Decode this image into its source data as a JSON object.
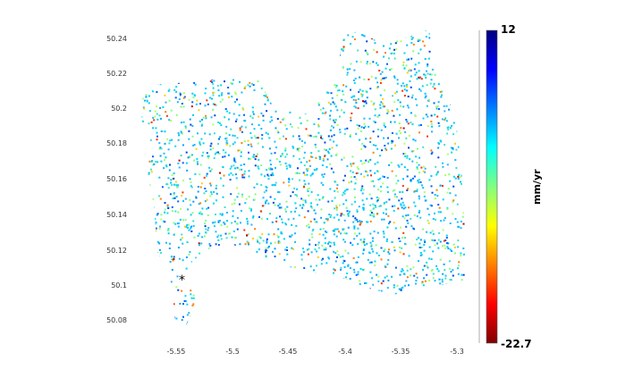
{
  "map": {
    "y_ticks": [
      "50.24",
      "50.22",
      "50.2",
      "50.18",
      "50.16",
      "50.14",
      "50.12",
      "50.1",
      "50.08"
    ],
    "x_ticks": [
      "-5.55",
      "-5.5",
      "-5.45",
      "-5.4",
      "-5.35",
      "-5.3"
    ],
    "reference_marker": "*"
  },
  "colorbar": {
    "max_label": "12",
    "min_label": "-22.7",
    "unit_label": "mm/yr",
    "colormap": "jet",
    "colors": [
      "#7f0000",
      "#ff0000",
      "#ff8000",
      "#ffff00",
      "#80ff80",
      "#00ffff",
      "#0080ff",
      "#0000ff",
      "#00007f"
    ]
  }
}
